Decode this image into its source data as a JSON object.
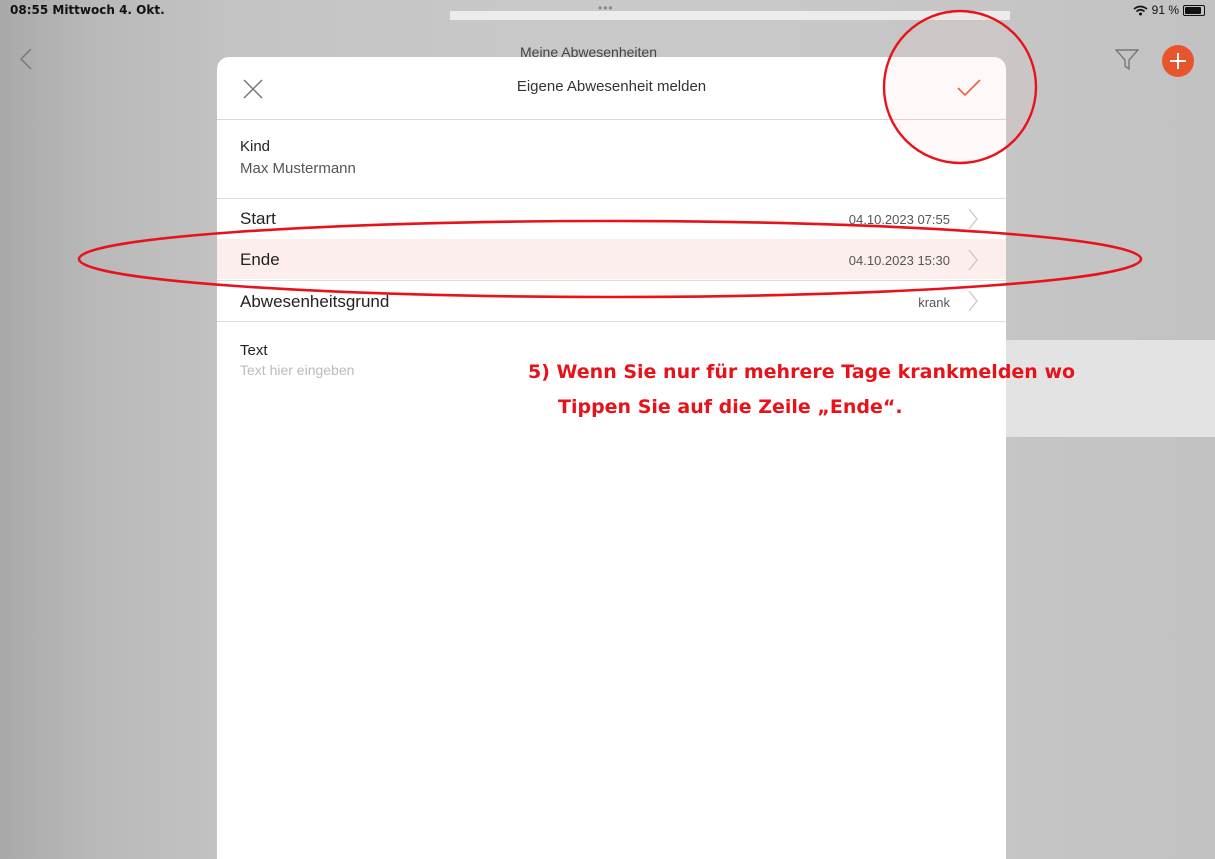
{
  "status_bar": {
    "time_date": "08:55  Mittwoch 4. Okt.",
    "dots": "•••",
    "battery": "91 %"
  },
  "navbar": {
    "title": "Meine Abwesenheiten"
  },
  "sheet": {
    "title": "Eigene Abwesenheit melden",
    "child": {
      "label": "Kind",
      "value": "Max Mustermann"
    },
    "rows": [
      {
        "label": "Start",
        "value": "04.10.2023 07:55"
      },
      {
        "label": "Ende",
        "value": "04.10.2023 15:30"
      },
      {
        "label": "Abwesenheitsgrund",
        "value": "krank"
      }
    ],
    "text_field": {
      "label": "Text",
      "placeholder": "Text hier eingeben"
    }
  },
  "annotation": {
    "line1": "5)  Wenn Sie nur für mehrere Tage krankmelden wo",
    "line2": "Tippen Sie auf die Zeile „Ende“."
  },
  "colors": {
    "accent": "#e8542c",
    "annotation_red": "#e8131a",
    "highlight_bg": "#fdeeee"
  },
  "icons": [
    "back-chevron-icon",
    "filter-icon",
    "add-icon",
    "close-icon",
    "checkmark-icon",
    "chevron-right-icon",
    "wifi-icon",
    "battery-icon"
  ]
}
